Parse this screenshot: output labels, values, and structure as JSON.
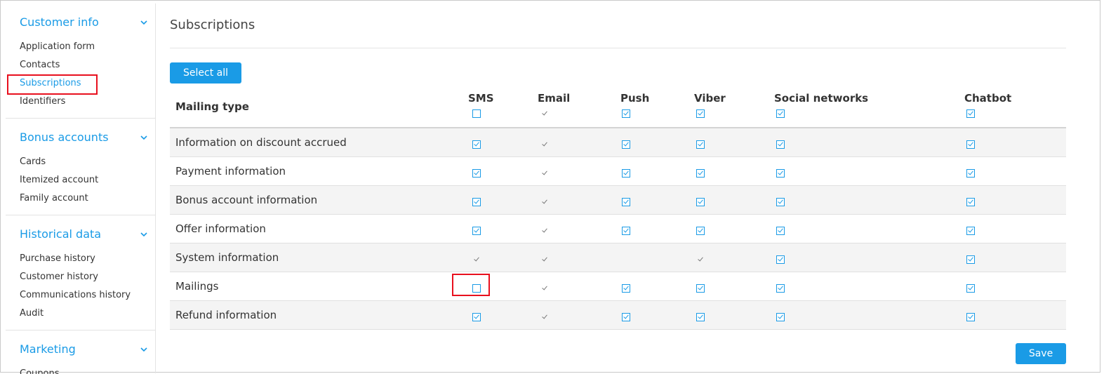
{
  "sidebar": {
    "groups": [
      {
        "title": "Customer info",
        "items": [
          "Application form",
          "Contacts",
          "Subscriptions",
          "Identifiers"
        ]
      },
      {
        "title": "Bonus accounts",
        "items": [
          "Cards",
          "Itemized account",
          "Family account"
        ]
      },
      {
        "title": "Historical data",
        "items": [
          "Purchase history",
          "Customer history",
          "Communications history",
          "Audit"
        ]
      },
      {
        "title": "Marketing",
        "items": [
          "Coupons"
        ]
      }
    ],
    "active_item": "Subscriptions"
  },
  "main": {
    "title": "Subscriptions",
    "select_all_label": "Select all",
    "save_label": "Save"
  },
  "table": {
    "row_header": "Mailing type",
    "columns": [
      {
        "name": "SMS",
        "header_state": "unchecked"
      },
      {
        "name": "Email",
        "header_state": "tick"
      },
      {
        "name": "Push",
        "header_state": "checked"
      },
      {
        "name": "Viber",
        "header_state": "checked"
      },
      {
        "name": "Social networks",
        "header_state": "checked"
      },
      {
        "name": "Chatbot",
        "header_state": "checked"
      }
    ],
    "rows": [
      {
        "label": "Information on discount accrued",
        "states": [
          "checked",
          "tick",
          "checked",
          "checked",
          "checked",
          "checked"
        ]
      },
      {
        "label": "Payment information",
        "states": [
          "checked",
          "tick",
          "checked",
          "checked",
          "checked",
          "checked"
        ]
      },
      {
        "label": "Bonus account information",
        "states": [
          "checked",
          "tick",
          "checked",
          "checked",
          "checked",
          "checked"
        ]
      },
      {
        "label": "Offer information",
        "states": [
          "checked",
          "tick",
          "checked",
          "checked",
          "checked",
          "checked"
        ]
      },
      {
        "label": "System information",
        "states": [
          "tick",
          "tick",
          "none",
          "tick",
          "checked",
          "checked"
        ]
      },
      {
        "label": "Mailings",
        "states": [
          "unchecked",
          "tick",
          "checked",
          "checked",
          "checked",
          "checked"
        ],
        "highlighted_column": 0
      },
      {
        "label": "Refund information",
        "states": [
          "checked",
          "tick",
          "checked",
          "checked",
          "checked",
          "checked"
        ]
      }
    ]
  },
  "colors": {
    "accent": "#1a9be6",
    "highlight": "#e8101e"
  }
}
